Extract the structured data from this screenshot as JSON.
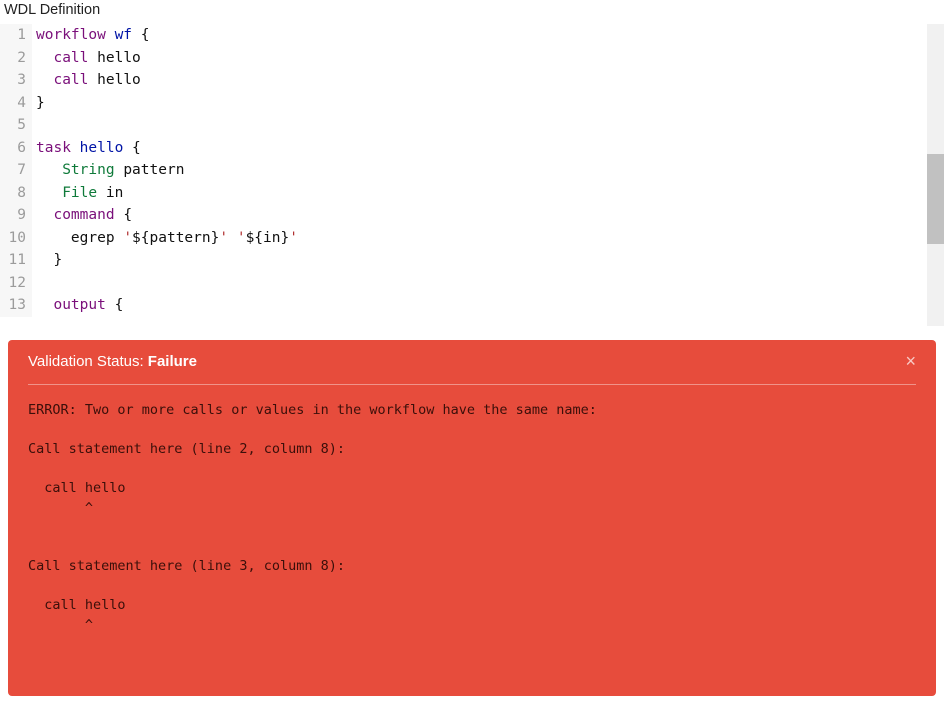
{
  "header": {
    "title": "WDL Definition"
  },
  "editor": {
    "lines": [
      {
        "n": 1,
        "tokens": [
          [
            "kw",
            "workflow"
          ],
          [
            "sp",
            " "
          ],
          [
            "name",
            "wf"
          ],
          [
            "sp",
            " "
          ],
          [
            "punct",
            "{"
          ]
        ]
      },
      {
        "n": 2,
        "tokens": [
          [
            "sp",
            "  "
          ],
          [
            "kw",
            "call"
          ],
          [
            "sp",
            " "
          ],
          [
            "varname",
            "hello"
          ]
        ]
      },
      {
        "n": 3,
        "tokens": [
          [
            "sp",
            "  "
          ],
          [
            "kw",
            "call"
          ],
          [
            "sp",
            " "
          ],
          [
            "varname",
            "hello"
          ]
        ]
      },
      {
        "n": 4,
        "tokens": [
          [
            "punct",
            "}"
          ]
        ]
      },
      {
        "n": 5,
        "tokens": []
      },
      {
        "n": 6,
        "tokens": [
          [
            "kw",
            "task"
          ],
          [
            "sp",
            " "
          ],
          [
            "name",
            "hello"
          ],
          [
            "sp",
            " "
          ],
          [
            "punct",
            "{"
          ]
        ]
      },
      {
        "n": 7,
        "tokens": [
          [
            "sp",
            "   "
          ],
          [
            "type",
            "String"
          ],
          [
            "sp",
            " "
          ],
          [
            "varname",
            "pattern"
          ]
        ]
      },
      {
        "n": 8,
        "tokens": [
          [
            "sp",
            "   "
          ],
          [
            "type",
            "File"
          ],
          [
            "sp",
            " "
          ],
          [
            "varname",
            "in"
          ]
        ]
      },
      {
        "n": 9,
        "tokens": [
          [
            "sp",
            "  "
          ],
          [
            "kw",
            "command"
          ],
          [
            "sp",
            " "
          ],
          [
            "punct",
            "{"
          ]
        ]
      },
      {
        "n": 10,
        "tokens": [
          [
            "sp",
            "    "
          ],
          [
            "varname",
            "egrep "
          ],
          [
            "str",
            "'"
          ],
          [
            "interp",
            "${pattern}"
          ],
          [
            "str",
            "' '"
          ],
          [
            "interp",
            "${in}"
          ],
          [
            "str",
            "'"
          ]
        ]
      },
      {
        "n": 11,
        "tokens": [
          [
            "sp",
            "  "
          ],
          [
            "punct",
            "}"
          ]
        ]
      },
      {
        "n": 12,
        "tokens": []
      },
      {
        "n": 13,
        "tokens": [
          [
            "sp",
            "  "
          ],
          [
            "kw",
            "output"
          ],
          [
            "sp",
            " "
          ],
          [
            "punct",
            "{"
          ]
        ]
      }
    ]
  },
  "status": {
    "label": "Validation Status: ",
    "result": "Failure",
    "close_label": "×",
    "body": "ERROR: Two or more calls or values in the workflow have the same name:\n\nCall statement here (line 2, column 8):\n\n  call hello\n       ^\n\n\nCall statement here (line 3, column 8):\n\n  call hello\n       ^"
  }
}
